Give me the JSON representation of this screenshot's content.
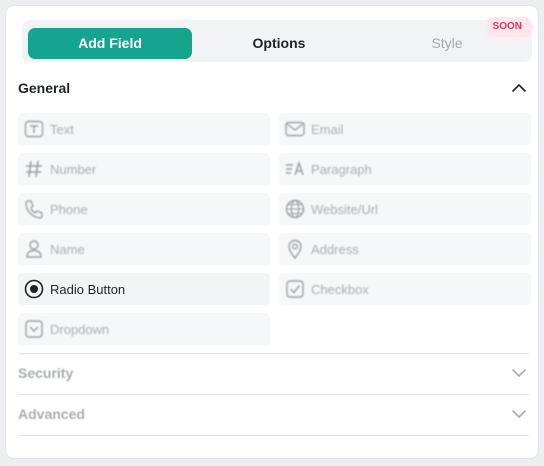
{
  "tabs": {
    "add_field": "Add Field",
    "options": "Options",
    "style": "Style",
    "soon_badge": "SOON"
  },
  "sections": {
    "general": "General",
    "security": "Security",
    "advanced": "Advanced"
  },
  "fields": [
    {
      "label": "Text",
      "icon": "text-icon"
    },
    {
      "label": "Email",
      "icon": "mail-icon"
    },
    {
      "label": "Number",
      "icon": "hash-icon"
    },
    {
      "label": "Paragraph",
      "icon": "paragraph-icon"
    },
    {
      "label": "Phone",
      "icon": "phone-icon"
    },
    {
      "label": "Website/Url",
      "icon": "globe-icon"
    },
    {
      "label": "Name",
      "icon": "user-icon"
    },
    {
      "label": "Address",
      "icon": "location-pin-icon"
    },
    {
      "label": "Radio Button",
      "icon": "radio-icon"
    },
    {
      "label": "Checkbox",
      "icon": "checkbox-icon"
    },
    {
      "label": "Dropdown",
      "icon": "dropdown-icon"
    }
  ],
  "colors": {
    "accent": "#15a58f",
    "soon": "#d43b5a",
    "muted": "#a9adb2"
  }
}
